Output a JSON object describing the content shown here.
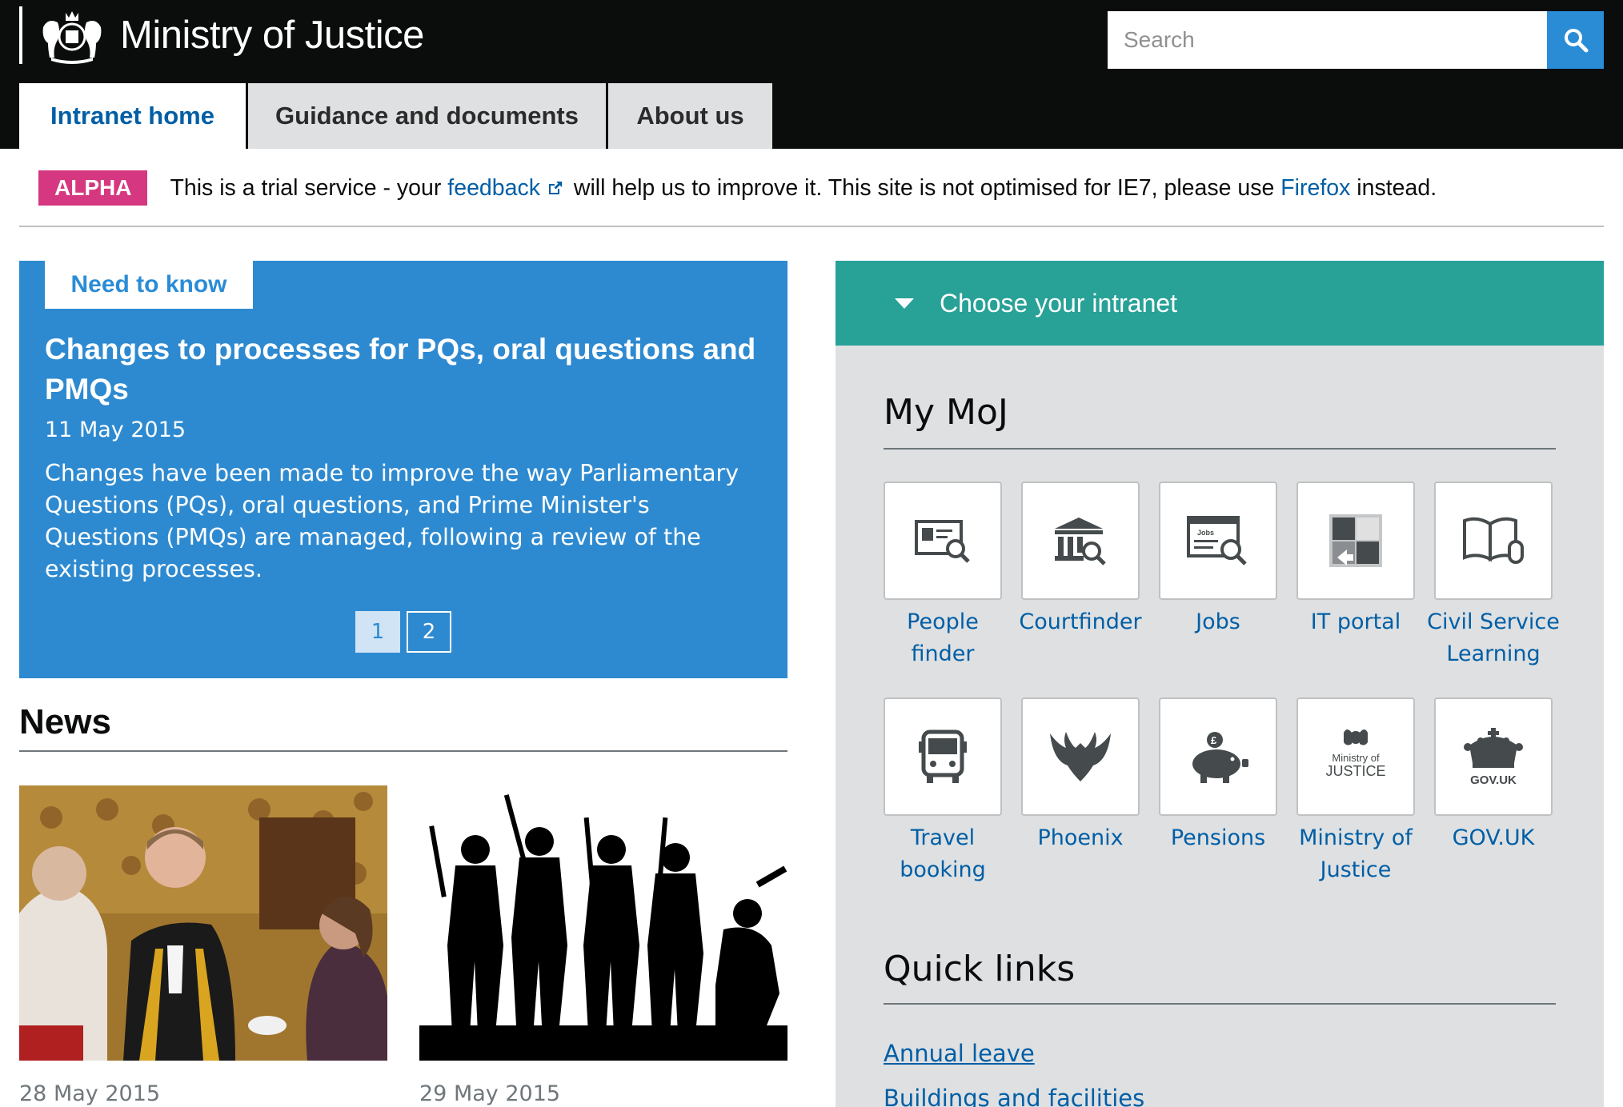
{
  "header": {
    "title": "Ministry of Justice",
    "search_placeholder": "Search"
  },
  "tabs": [
    {
      "label": "Intranet home",
      "active": true
    },
    {
      "label": "Guidance and documents",
      "active": false
    },
    {
      "label": "About us",
      "active": false
    }
  ],
  "alpha": {
    "tag": "ALPHA",
    "text_before": "This is a trial service - your ",
    "feedback_link": "feedback",
    "text_middle": " will help us to improve it. This site is not optimised for IE7, please use ",
    "firefox_link": "Firefox",
    "text_after": " instead."
  },
  "need_to_know": {
    "label": "Need to know",
    "title": "Changes to processes for PQs, oral questions and PMQs",
    "date": "11 May 2015",
    "body": "Changes have been made to improve the way Parliamentary Questions (PQs), oral questions, and Prime Minister's Questions (PMQs) are managed, following a review of the existing processes.",
    "pages": [
      "1",
      "2"
    ],
    "current_page": "1"
  },
  "news": {
    "heading": "News",
    "items": [
      {
        "date": "28 May 2015"
      },
      {
        "date": "29 May 2015"
      }
    ]
  },
  "choose_intranet": {
    "label": "Choose your intranet"
  },
  "my_moj": {
    "heading": "My MoJ",
    "tiles": [
      {
        "label": "People finder",
        "icon": "people-finder-icon"
      },
      {
        "label": "Courtfinder",
        "icon": "courtfinder-icon"
      },
      {
        "label": "Jobs",
        "icon": "jobs-icon"
      },
      {
        "label": "IT portal",
        "icon": "it-portal-icon"
      },
      {
        "label": "Civil Service Learning",
        "icon": "civil-service-learning-icon"
      },
      {
        "label": "Travel booking",
        "icon": "travel-booking-icon"
      },
      {
        "label": "Phoenix",
        "icon": "phoenix-icon"
      },
      {
        "label": "Pensions",
        "icon": "pensions-icon"
      },
      {
        "label": "Ministry of Justice",
        "icon": "moj-logo-icon"
      },
      {
        "label": "GOV.UK",
        "icon": "govuk-crown-icon"
      }
    ],
    "logo_text": {
      "moj_line1": "Ministry of",
      "moj_line2": "JUSTICE",
      "govuk": "GOV.UK",
      "jobs": "Jobs"
    }
  },
  "quick_links": {
    "heading": "Quick links",
    "links": [
      "Annual leave",
      "Buildings and facilities"
    ]
  },
  "colors": {
    "header_bg": "#0b0c0c",
    "link_blue": "#005ea5",
    "need_to_know_bg": "#2e8ad0",
    "choose_bg": "#28a197",
    "alpha_pink": "#d53880",
    "panel_bg": "#dee0e2"
  }
}
